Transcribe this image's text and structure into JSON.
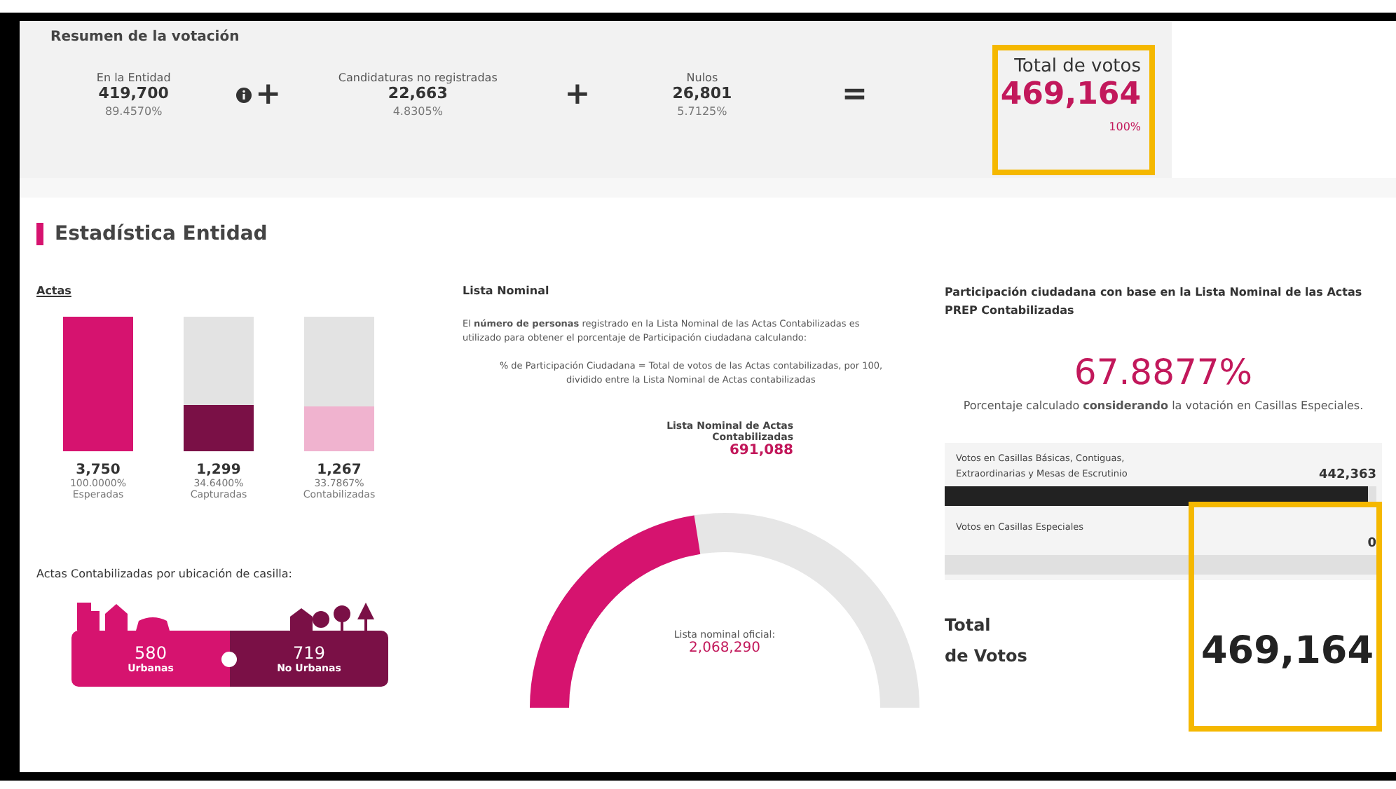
{
  "summary": {
    "title": "Resumen de la votación",
    "items": [
      {
        "label": "En la Entidad",
        "value": "419,700",
        "percent": "89.4570%",
        "info": true
      },
      {
        "label": "Candidaturas no registradas",
        "value": "22,663",
        "percent": "4.8305%"
      },
      {
        "label": "Nulos",
        "value": "26,801",
        "percent": "5.7125%"
      }
    ],
    "operators": [
      "+",
      "+",
      "="
    ],
    "total": {
      "label": "Total de votos",
      "value": "469,164",
      "percent": "100%"
    }
  },
  "stats": {
    "title": "Estadística Entidad",
    "actas": {
      "title": "Actas",
      "bars": [
        {
          "value": "3,750",
          "percent": "100.0000%",
          "label": "Esperadas",
          "level": 1,
          "color": "#d6136f"
        },
        {
          "value": "1,299",
          "percent": "34.6400%",
          "label": "Capturadas",
          "level": 0.3464,
          "color": "#7a1046"
        },
        {
          "value": "1,267",
          "percent": "33.7867%",
          "label": "Contabilizadas",
          "level": 0.3379,
          "color": "#f0b3cf"
        }
      ]
    },
    "location": {
      "title": "Actas Contabilizadas por ubicación de casilla:",
      "segments": [
        {
          "value": "580",
          "label": "Urbanas",
          "color": "#d6136f"
        },
        {
          "value": "719",
          "label": "No Urbanas",
          "color": "#7a1046"
        }
      ]
    },
    "nominal": {
      "title": "Lista Nominal",
      "paragraph": "El **número de personas** registrado en la Lista Nominal de las Actas Contabilizadas es utilizado para obtener el porcentaje de Participación ciudadana calculando:",
      "formula": "% de Participación Ciudadana = Total de votos de las Actas contabilizadas, por 100, dividido entre la Lista Nominal de Actas contabilizadas",
      "counted": {
        "label": "Lista Nominal de Actas Contabilizadas",
        "value": "691,088"
      },
      "gauge": {
        "level": 0.45,
        "label": "Lista nominal oficial:",
        "value": "2,068,290"
      }
    },
    "participation": {
      "title": "Participación ciudadana con base en la Lista Nominal de las Actas PREP Contabilizadas",
      "value": "67.8877%",
      "note": "Porcentaje calculado **considerando** la votación en Casillas Especiales.",
      "rows": [
        {
          "label": "Votos en Casillas Básicas, Contiguas, Extraordinarias y Mesas de Escrutinio",
          "value": "442,363",
          "level": 0.98,
          "color": "#222222"
        },
        {
          "label": "Votos en Casillas Especiales",
          "value": "0"
        }
      ],
      "total": {
        "label_lines": [
          "Total",
          "de Votos"
        ],
        "value": "469,164"
      }
    }
  }
}
